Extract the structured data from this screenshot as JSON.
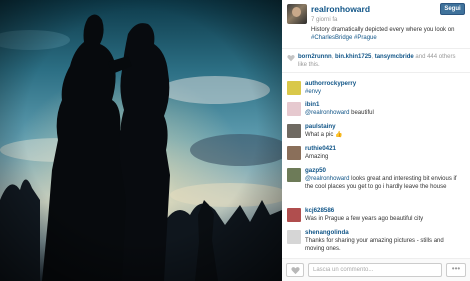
{
  "post": {
    "username": "realronhoward",
    "follow_label": "Segui",
    "time": "7 giorni fa",
    "caption_text": "History dramatically depicted every where you look on",
    "caption_tags": [
      "#CharlesBridge",
      "#Prague"
    ]
  },
  "likes": {
    "users": [
      "born2runnn",
      "bin.khin1725",
      "tansymcbride"
    ],
    "sep1": ", ",
    "sep2": " and ",
    "rest": "444 others like this."
  },
  "comments": [
    {
      "user": "authorrockyperry",
      "text": "#envy",
      "avatar_color": "#d9c84a"
    },
    {
      "user": "ibin1",
      "mention": "@realronhoward",
      "text": " beautiful",
      "avatar_color": "#e6c9cf"
    },
    {
      "user": "paulstainy",
      "text": "What a pic 👍",
      "avatar_color": "#6f6a62"
    },
    {
      "user": "ruthie0421",
      "text": "Amazing",
      "avatar_color": "#8a6f5a"
    },
    {
      "user": "gazp50",
      "mention": "@realronhoward",
      "text": " looks great and interesting bit envious if the cool places you get to go i hardly leave the house",
      "avatar_color": "#6d7b58"
    },
    {
      "user": "kcj628586",
      "text": "Was in Prague a few years ago beautiful city",
      "avatar_color": "#b04e4e"
    },
    {
      "user": "shenangolinda",
      "text": "Thanks for sharing your amazing pictures - stills and moving ones.",
      "avatar_color": "#d6d6d6"
    }
  ],
  "footer": {
    "comment_placeholder": "Lascia un commento...",
    "more_label": "•••"
  },
  "colors": {
    "link_blue": "#125688",
    "follow_blue": "#3f729b"
  }
}
